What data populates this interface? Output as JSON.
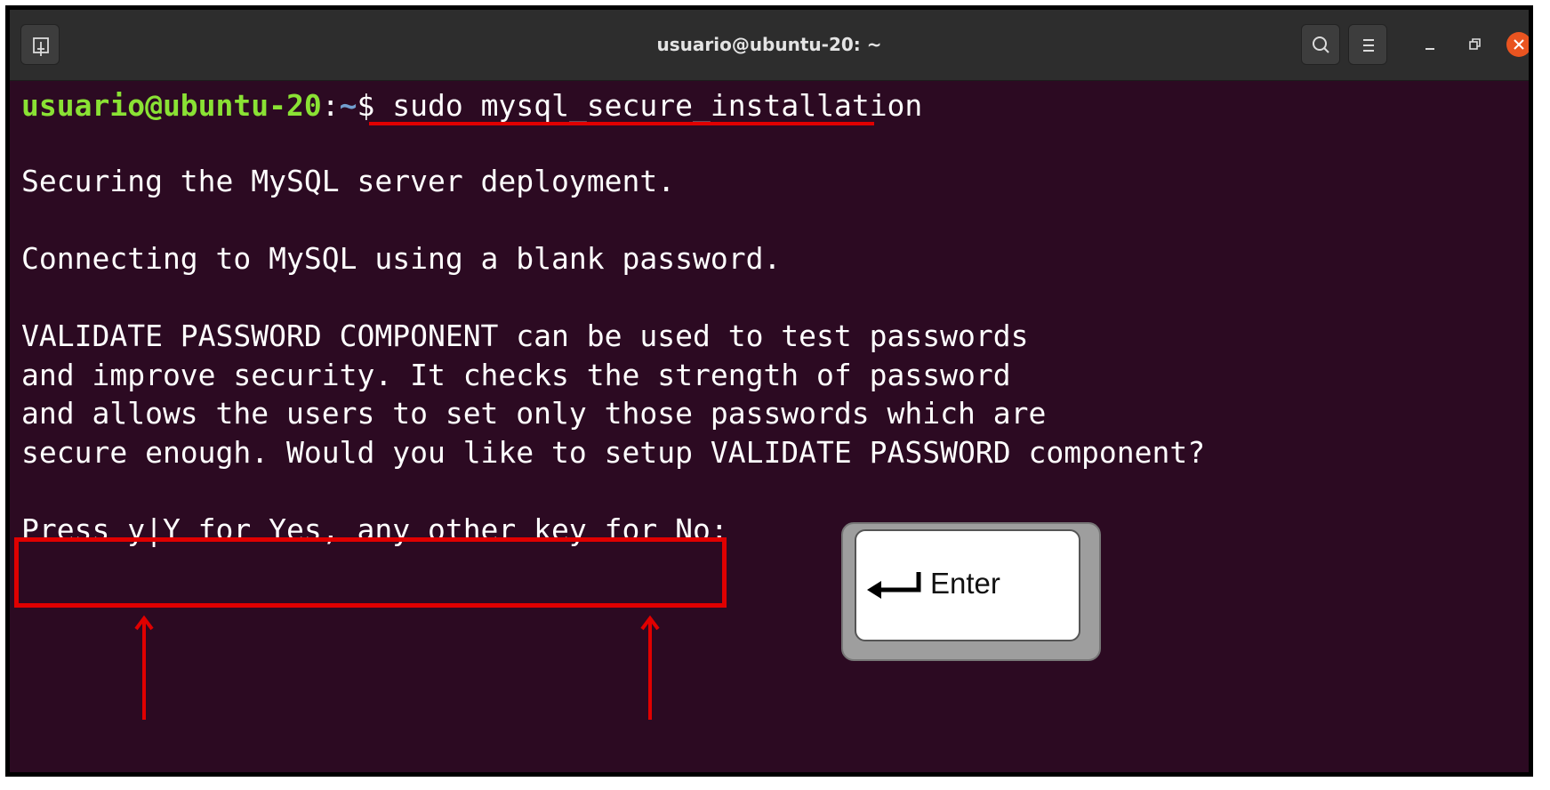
{
  "window": {
    "title": "usuario@ubuntu-20: ~"
  },
  "titlebar": {
    "new_tab_icon": "new-tab-icon",
    "search_icon": "search-icon",
    "menu_icon": "hamburger-menu-icon",
    "minimize_icon": "minimize-icon",
    "maximize_icon": "restore-icon",
    "close_icon": "close-icon"
  },
  "terminal": {
    "prompt": {
      "user_host": "usuario@ubuntu-20",
      "separator": ":",
      "path": "~",
      "symbol": "$",
      "command": "sudo mysql_secure_installation"
    },
    "output": [
      "Securing the MySQL server deployment.",
      "Connecting to MySQL using a blank password.",
      "VALIDATE PASSWORD COMPONENT can be used to test passwords",
      "and improve security. It checks the strength of password",
      "and allows the users to set only those passwords which are",
      "secure enough. Would you like to setup VALIDATE PASSWORD component?",
      "Press y|Y for Yes, any other key for No:"
    ]
  },
  "annotations": {
    "enter_key_label": "Enter",
    "accent_color": "#e00000"
  },
  "colors": {
    "terminal_bg": "#2c0a22",
    "titlebar_bg": "#2d2d2d",
    "prompt_user": "#8ae234",
    "prompt_path": "#729fcf",
    "close_button": "#e95420"
  }
}
